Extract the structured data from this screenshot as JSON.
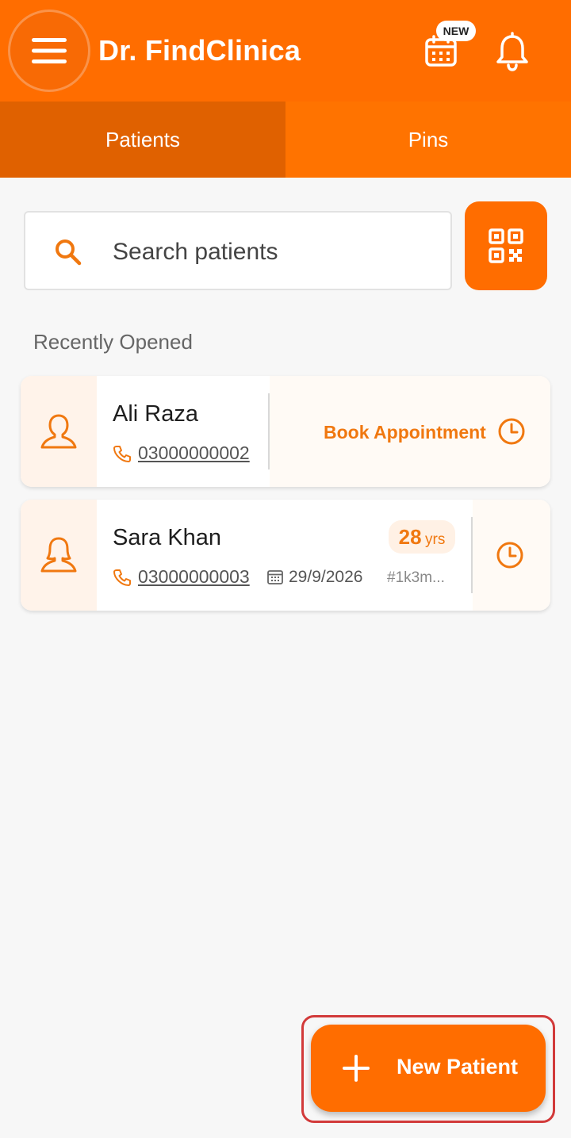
{
  "app": {
    "title": "Dr. FindClinica",
    "new_badge": "NEW",
    "brand_color": "#ff6d00"
  },
  "tabs": [
    {
      "label": "Patients",
      "active": true
    },
    {
      "label": "Pins",
      "active": false
    }
  ],
  "search": {
    "placeholder": "Search patients",
    "value": ""
  },
  "section": {
    "recent_label": "Recently Opened"
  },
  "patients": [
    {
      "name": "Ali Raza",
      "phone": "03000000002",
      "action_label": "Book Appointment"
    },
    {
      "name": "Sara Khan",
      "phone": "03000000003",
      "age": "28",
      "age_unit": "yrs",
      "date": "29/9/2026",
      "id": "#1k3m..."
    }
  ],
  "fab": {
    "label": "New Patient"
  },
  "icons": {
    "menu": "hamburger-menu-icon",
    "calendar": "calendar-icon",
    "bell": "bell-icon",
    "search": "search-icon",
    "qr": "qr-code-icon",
    "avatar": "person-icon",
    "phone": "phone-icon",
    "clock": "clock-icon",
    "plus": "plus-icon"
  }
}
